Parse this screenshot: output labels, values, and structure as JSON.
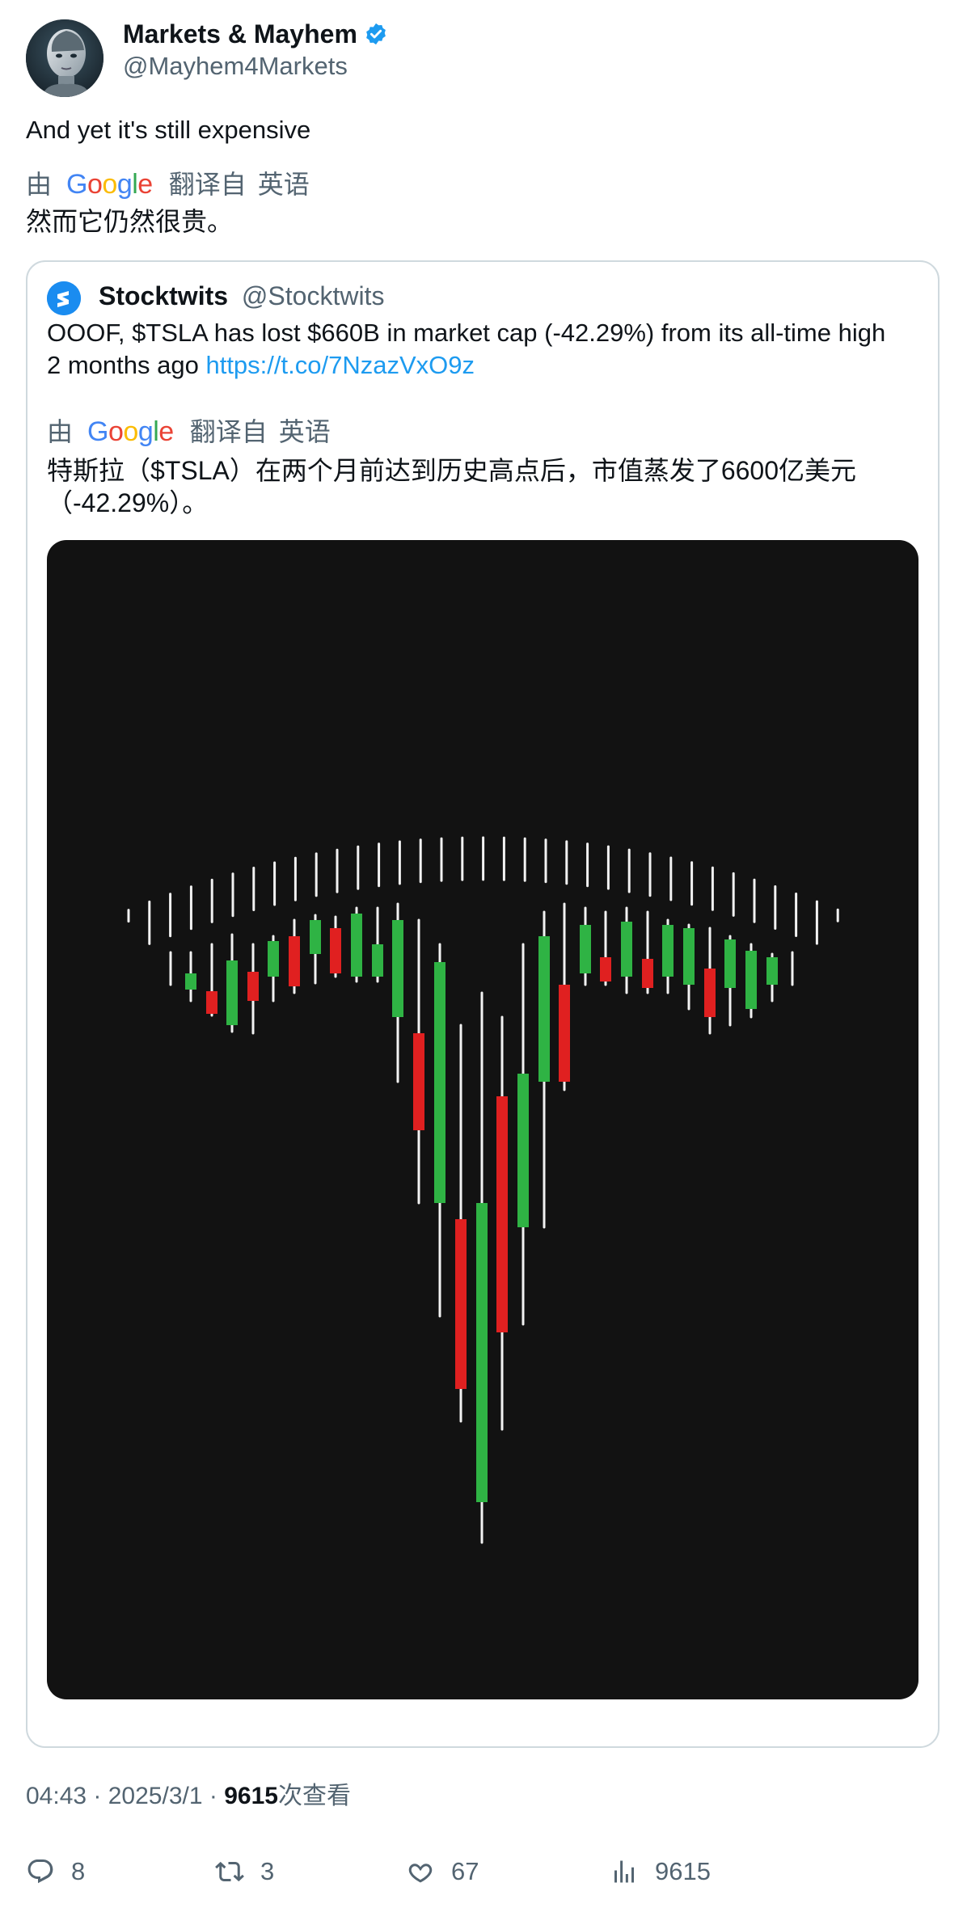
{
  "author": {
    "name": "Markets & Mayhem",
    "handle": "@Mayhem4Markets",
    "avatar_icon": "robot-head-avatar",
    "verified_icon": "verified-badge-icon",
    "verified_color": "#1d9bf0"
  },
  "post": {
    "text": "And yet it's still expensive",
    "translation": {
      "by_label": "由",
      "provider_name": "Google",
      "label": "翻译自",
      "source_language": "英语",
      "text": "然而它仍然很贵。"
    }
  },
  "quote": {
    "name": "Stocktwits",
    "handle": "@Stocktwits",
    "avatar_icon": "stocktwits-logo-icon",
    "text_line1": "OOOF, $TSLA has lost $660B in market cap (-42.29%) from its all-time high",
    "text_line2_prefix": "2 months ago ",
    "link": "https://t.co/7NzazVxO9z",
    "translation": {
      "by_label": "由",
      "provider_name": "Google",
      "label": "翻译自",
      "source_language": "英语",
      "text_line1": "特斯拉（$TSLA）在两个月前达到历史高点后，市值蒸发了6600亿美元",
      "text_line2": "（-42.29%）。"
    },
    "image": {
      "background": "#121212",
      "up_color": "#2fb344",
      "down_color": "#e02020",
      "wick_color": "#f2f2f2"
    }
  },
  "meta": {
    "time": "04:43",
    "separator": " · ",
    "date": "2025/3/1",
    "views_count": "9615",
    "views_label": "次查看"
  },
  "actions": {
    "replies": "8",
    "reposts": "3",
    "likes": "67",
    "views": "9615"
  }
}
